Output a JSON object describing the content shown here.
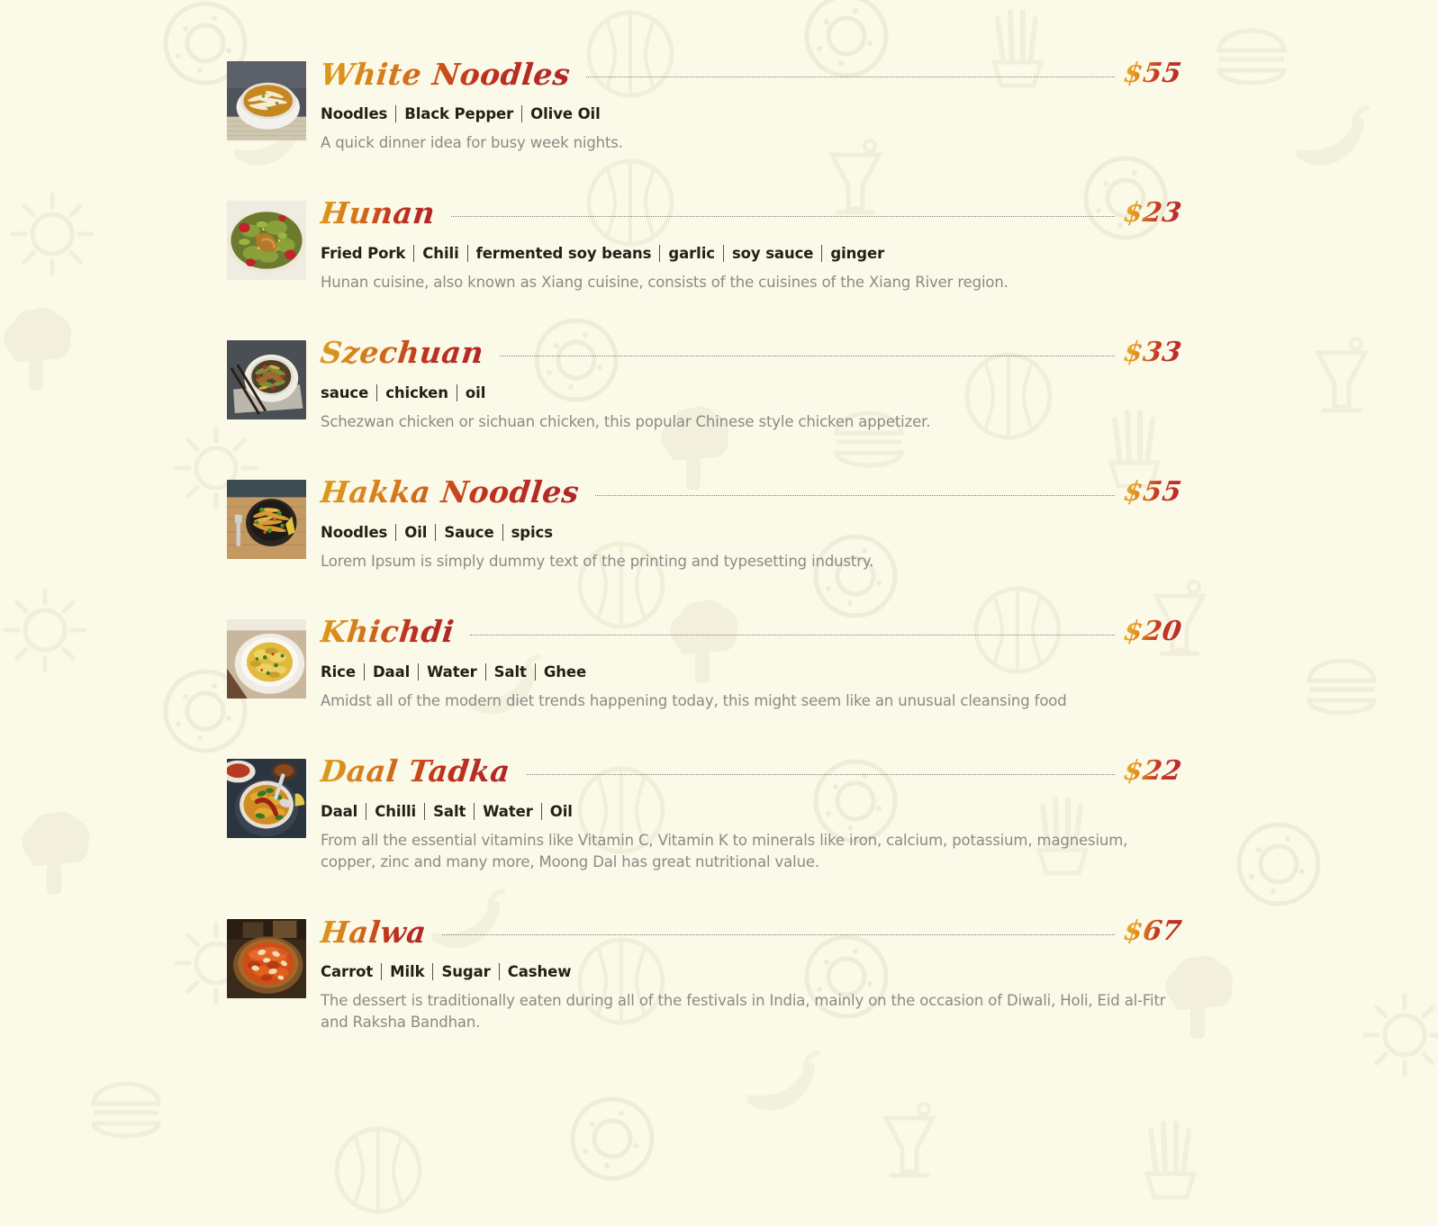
{
  "page": {
    "background_color": "#fbf9e8",
    "accent_gold": "#e8a621",
    "accent_red": "#b8282c",
    "ingredient_color": "#231f16",
    "description_color": "#8c8a84",
    "currency_symbol": "$"
  },
  "menu": {
    "items": [
      {
        "name": "White Noodles",
        "price": "$55",
        "ingredients": [
          "Noodles",
          "Black Pepper",
          "Olive Oil"
        ],
        "description": "A quick dinner idea for busy week nights.",
        "image": "noodle-soup-white-bowl-photo"
      },
      {
        "name": "Hunan",
        "price": "$23",
        "ingredients": [
          "Fried Pork",
          "Chili",
          "fermented soy beans",
          "garlic",
          "soy sauce",
          "ginger"
        ],
        "description": "Hunan cuisine, also known as Xiang cuisine, consists of the cuisines of the Xiang River region.",
        "image": "green-beans-pork-chili-photo"
      },
      {
        "name": "Szechuan",
        "price": "$33",
        "ingredients": [
          "sauce",
          "chicken",
          "oil"
        ],
        "description": "Schezwan chicken or sichuan chicken, this popular Chinese style chicken appetizer.",
        "image": "stirfry-bowl-chopsticks-photo"
      },
      {
        "name": "Hakka Noodles",
        "price": "$55",
        "ingredients": [
          "Noodles",
          "Oil",
          "Sauce",
          "spics"
        ],
        "description": "Lorem Ipsum is simply dummy text of the printing and typesetting industry.",
        "image": "hakka-noodles-dark-bowl-photo"
      },
      {
        "name": "Khichdi",
        "price": "$20",
        "ingredients": [
          "Rice",
          "Daal",
          "Water",
          "Salt",
          "Ghee"
        ],
        "description": "Amidst all of the modern diet trends happening today, this might seem like an unusual cleansing food",
        "image": "khichdi-yellow-rice-bowl-photo"
      },
      {
        "name": "Daal Tadka",
        "price": "$22",
        "ingredients": [
          "Daal",
          "Chilli",
          "Salt",
          "Water",
          "Oil"
        ],
        "description": "From all the essential vitamins like Vitamin C, Vitamin K to minerals like iron, calcium, potassium, magnesium, copper, zinc and many more, Moong Dal has great nutritional value.",
        "image": "daal-tadka-dark-bowl-photo"
      },
      {
        "name": "Halwa",
        "price": "$67",
        "ingredients": [
          "Carrot",
          "Milk",
          "Sugar",
          "Cashew"
        ],
        "description": "The dessert is traditionally eaten during all of the festivals in India, mainly on the occasion of Diwali, Holi, Eid al-Fitr and Raksha Bandhan.",
        "image": "carrot-halwa-glass-bowl-photo"
      }
    ]
  }
}
